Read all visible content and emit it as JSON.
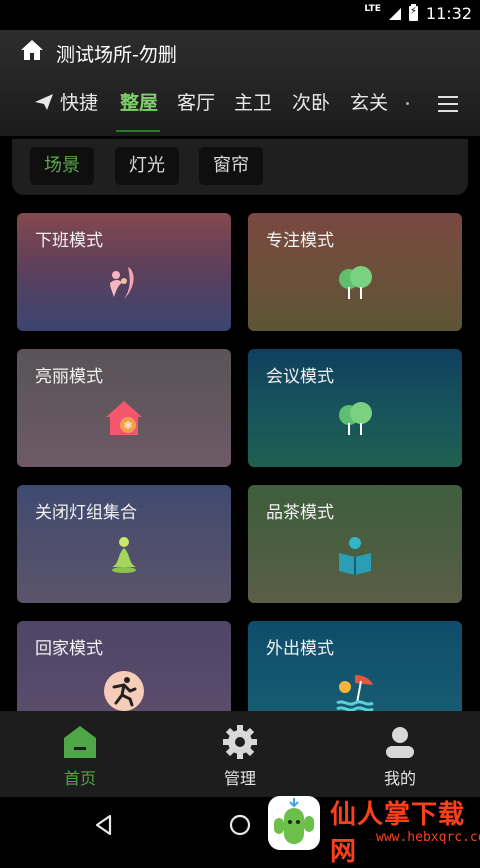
{
  "status_bar": {
    "network": "LTE",
    "time": "11:32"
  },
  "header": {
    "title": "测试场所-勿删"
  },
  "tabs": [
    {
      "label": "快捷",
      "active": false
    },
    {
      "label": "整屋",
      "active": true
    },
    {
      "label": "客厅",
      "active": false
    },
    {
      "label": "主卫",
      "active": false
    },
    {
      "label": "次卧",
      "active": false
    },
    {
      "label": "玄关",
      "active": false
    }
  ],
  "category_chips": [
    {
      "label": "场景",
      "active": true
    },
    {
      "label": "灯光",
      "active": false
    },
    {
      "label": "窗帘",
      "active": false
    }
  ],
  "scenes": [
    {
      "label": "下班模式",
      "icon": "people-icon"
    },
    {
      "label": "专注模式",
      "icon": "trees-icon"
    },
    {
      "label": "亮丽模式",
      "icon": "house-snowflake-icon"
    },
    {
      "label": "会议模式",
      "icon": "trees-icon"
    },
    {
      "label": "关闭灯组集合",
      "icon": "meditation-icon"
    },
    {
      "label": "品茶模式",
      "icon": "reading-icon"
    },
    {
      "label": "回家模式",
      "icon": "runner-icon"
    },
    {
      "label": "外出模式",
      "icon": "beach-icon"
    }
  ],
  "bottom_nav": [
    {
      "label": "首页",
      "icon": "home-icon",
      "active": true
    },
    {
      "label": "管理",
      "icon": "gear-icon",
      "active": false
    },
    {
      "label": "我的",
      "icon": "user-icon",
      "active": false
    }
  ],
  "watermark": {
    "text": "仙人掌下载网",
    "url": "www.hebxqrc.com"
  },
  "colors": {
    "accent": "#4fa646",
    "tab_active": "#7fd06b"
  }
}
